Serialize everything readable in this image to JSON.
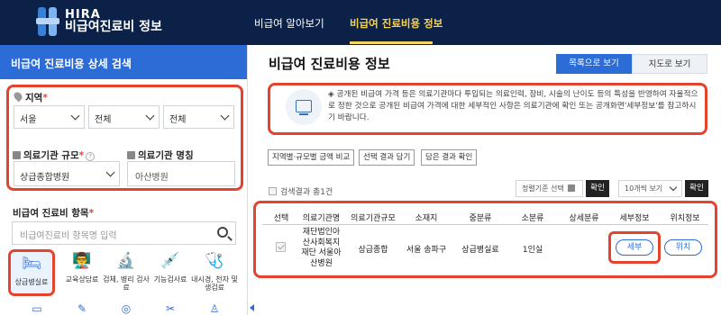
{
  "header": {
    "logo_top": "HIRA",
    "logo_bottom": "비급여진료비 정보",
    "nav": [
      "비급여 알아보기",
      "비급여 진료비용 정보"
    ]
  },
  "sidebar": {
    "title": "비급여 진료비용 상세 검색",
    "region_label": "지역",
    "region_required": "*",
    "region_selects": [
      "서울",
      "전체",
      "전체"
    ],
    "scale_label": "의료기관 규모",
    "scale_required": "*",
    "scale_value": "상급종합병원",
    "name_label": "의료기관 명칭",
    "name_value": "아산병원",
    "items_label": "비급여 진료비 항목",
    "items_required": "*",
    "items_placeholder": "비급여진료비 항목명 입력",
    "categories": [
      {
        "icon": "bed-icon",
        "label": "상급병실료"
      },
      {
        "icon": "classroom-icon",
        "label": "교육상담료"
      },
      {
        "icon": "microscope-icon",
        "label": "검체, 병리 검사료"
      },
      {
        "icon": "function-test-icon",
        "label": "기능검사료"
      },
      {
        "icon": "endoscope-icon",
        "label": "내시경, 천자 및 생검료"
      }
    ]
  },
  "main": {
    "title": "비급여 진료비용 정보",
    "view_list": "목록으로 보기",
    "view_map": "지도로 보기",
    "info": "◈ 공개된 비급여 가격 등은 의료기관마다 투입되는 의료인력, 장비, 시술의 난이도 등의 특성을 반영하여 자율적으로 정한 것으로 공개된 비급여 가격에 대한 세부적인 사항은 의료기관에 확인 또는 공개화면'세부정보'를 참고하시기 바랍니다.",
    "chips": [
      "지역별·규모별 금액 비교",
      "선택 결과 담기",
      "담은 결과 확인"
    ],
    "result_count": "검색결과 총1건",
    "sort_select": "정렬기준 선택",
    "sort_button": "확인",
    "page_size_select": "10개씩 보기",
    "page_size_button": "확인",
    "table": {
      "headers": [
        "선택",
        "의료기관명",
        "의료기관규모",
        "소재지",
        "중분류",
        "소분류",
        "상세분류",
        "세부정보",
        "위치정보"
      ],
      "row": {
        "name": "재단법인아산사회복지재단 서울아산병원",
        "name_lines": [
          "재단법인아",
          "산사회복지",
          "재단 서울아",
          "산병원"
        ],
        "scale": "상급종합",
        "location": "서울 송파구",
        "mid": "상급병실료",
        "sub": "1인실",
        "detail_button": "세부",
        "location_button": "위치"
      }
    }
  },
  "colors": {
    "header_bg": "#0b2148",
    "accent": "#2b6cd6",
    "active_nav": "#f4d35e",
    "highlight": "#e2442f"
  }
}
